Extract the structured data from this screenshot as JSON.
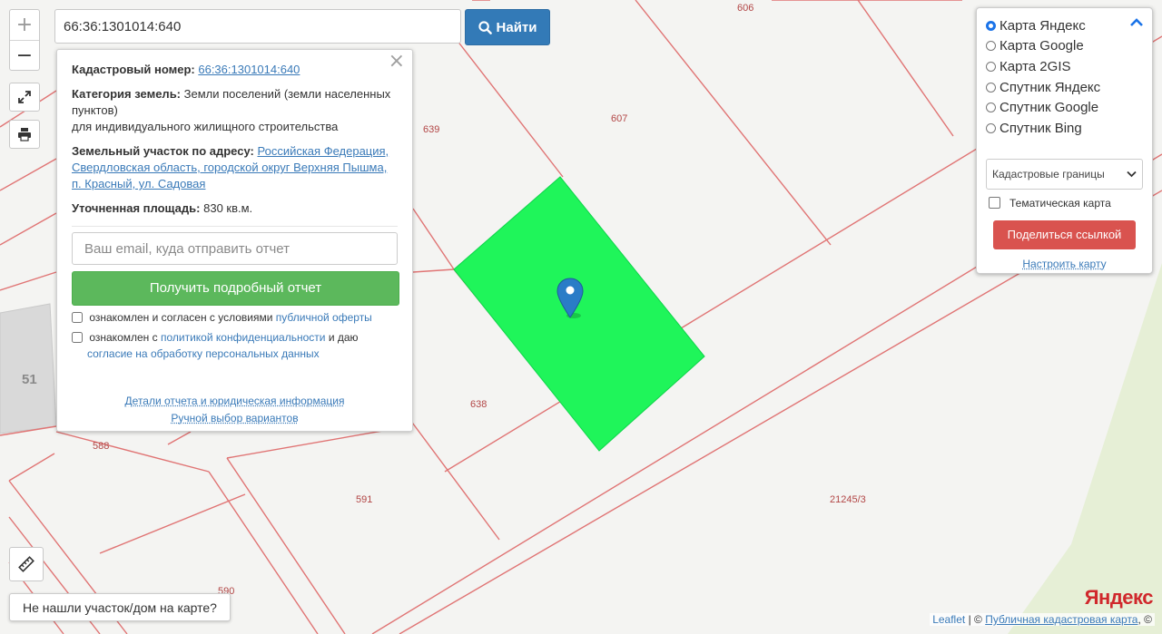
{
  "search": {
    "value": "66:36:1301014:640",
    "button_label": "Найти"
  },
  "map": {
    "labels": [
      "606",
      "607",
      "639",
      "638",
      "588",
      "591",
      "590",
      "51",
      "21245/3"
    ],
    "parcel_color": "#1ff55a"
  },
  "info": {
    "cadastral_label": "Кадастровый номер:",
    "cadastral_value": "66:36:1301014:640",
    "category_label": "Категория земель:",
    "category_value": "Земли поселений (земли населенных пунктов)",
    "category_use": "для индивидуального жилищного строительства",
    "address_label": "Земельный участок по адресу:",
    "address_value": "Российская Федерация, Свердловская область, городской округ Верхняя Пышма, п. Красный, ул. Садовая",
    "area_label": "Уточненная площадь:",
    "area_value": "830 кв.м.",
    "email_placeholder": "Ваш email, куда отправить отчет",
    "report_button": "Получить подробный отчет",
    "agree1_text": "ознакомлен и согласен с условиями",
    "agree1_link": "публичной оферты",
    "agree2_text": "ознакомлен с",
    "agree2_link": "политикой конфиденциальности",
    "agree2_mid": "и даю",
    "agree2_link2": "согласие на обработку персональных данных",
    "details_link": "Детали отчета и юридическая информация",
    "manual_link": "Ручной выбор вариантов"
  },
  "layers": {
    "items": [
      {
        "label": "Карта Яндекс",
        "selected": true
      },
      {
        "label": "Карта Google",
        "selected": false
      },
      {
        "label": "Карта 2GIS",
        "selected": false
      },
      {
        "label": "Спутник Яндекс",
        "selected": false
      },
      {
        "label": "Спутник Google",
        "selected": false
      },
      {
        "label": "Спутник Bing",
        "selected": false
      }
    ],
    "cadastral_select": "Кадастровые границы",
    "thematic_label": "Тематическая карта",
    "share_button": "Поделиться ссылкой",
    "configure_link": "Настроить карту"
  },
  "bottom": {
    "not_found": "Не нашли участок/дом на карте?",
    "yandex_logo": "Яндекс",
    "attr_leaflet": "Leaflet",
    "attr_sep": " | © ",
    "attr_cadastral": "Публичная кадастровая карта",
    "attr_tail": ", ©"
  },
  "colors": {
    "accent_blue": "#337ab7",
    "report_green": "#5cb85c",
    "share_red": "#d9534f",
    "boundary": "#e07474"
  }
}
